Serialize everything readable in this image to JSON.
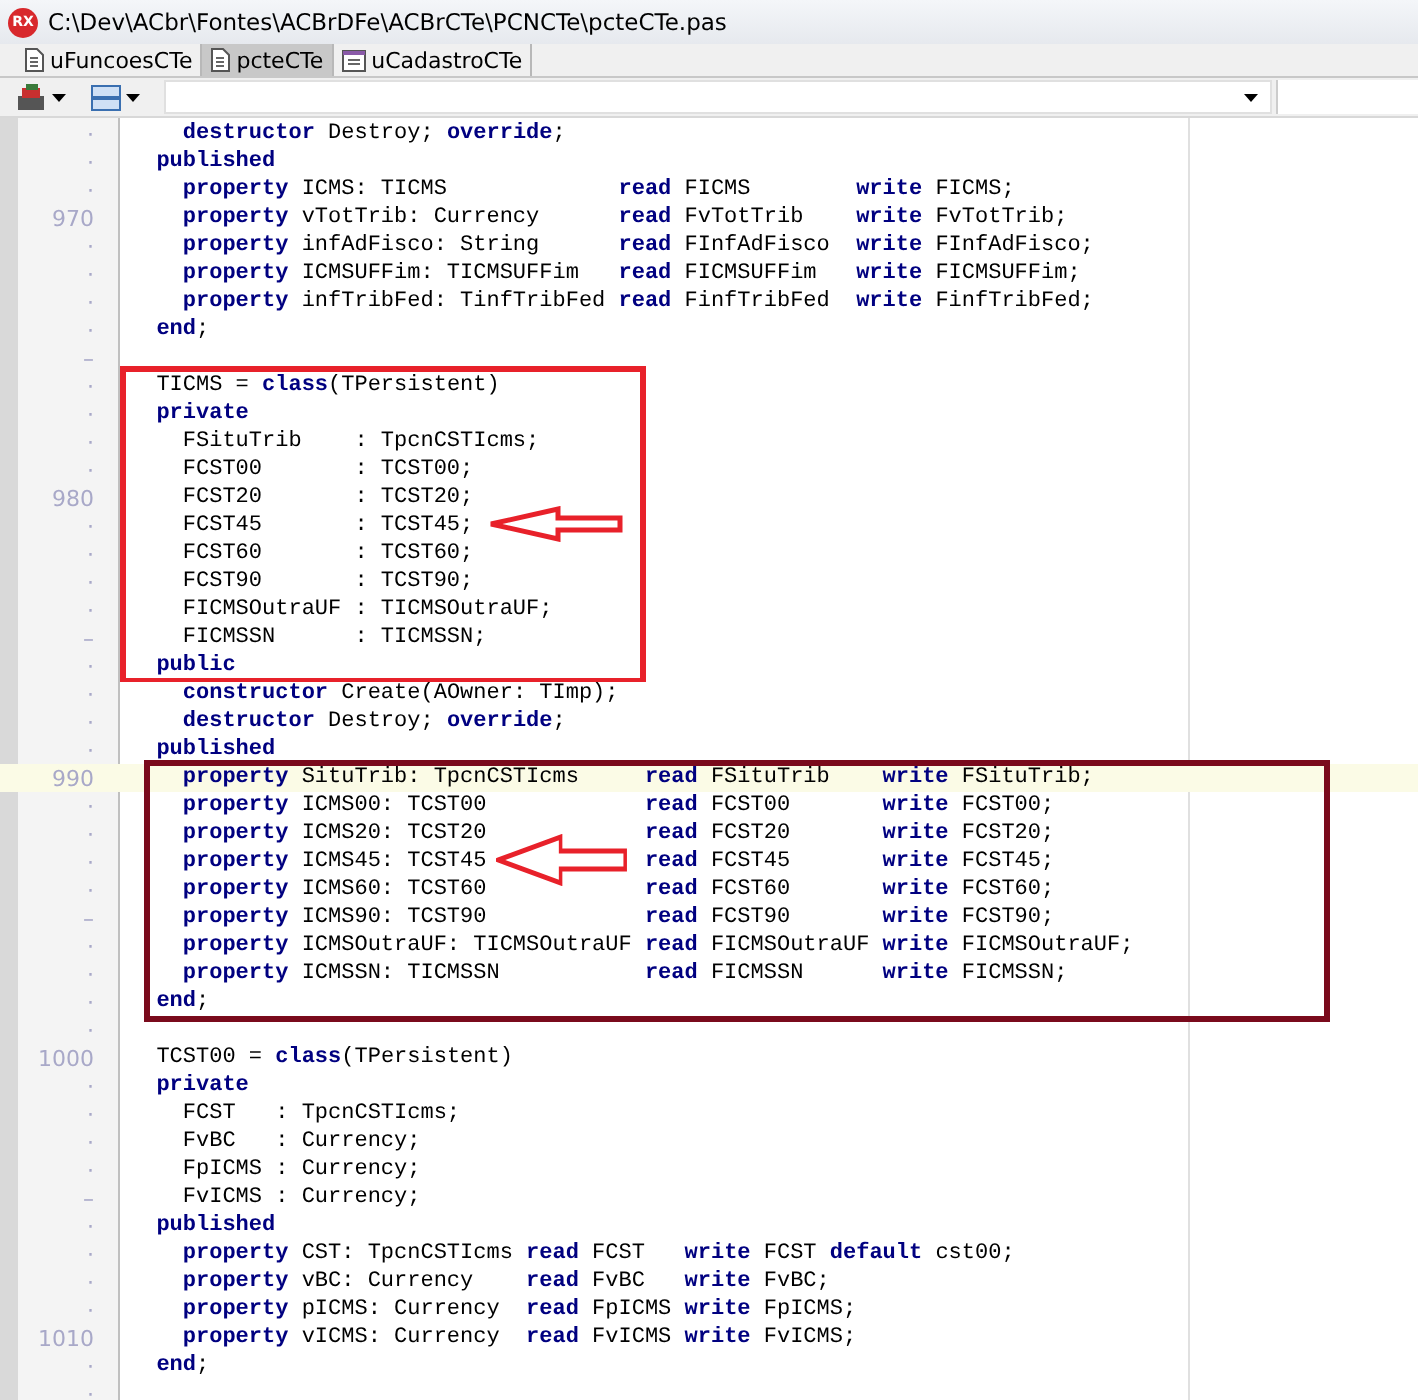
{
  "window": {
    "badge": "RX",
    "title": "C:\\Dev\\ACbr\\Fontes\\ACBrDFe\\ACBrCTe\\PCNCTe\\pcteCTe.pas"
  },
  "tabs": [
    {
      "label": "uFuncoesCTe",
      "selected": false,
      "kind": "unit"
    },
    {
      "label": "pcteCTe",
      "selected": true,
      "kind": "unit"
    },
    {
      "label": "uCadastroCTe",
      "selected": false,
      "kind": "form"
    }
  ],
  "editor": {
    "lines": [
      {
        "gutter": "·",
        "current": false,
        "code": "    **destructor** Destroy; **override**;"
      },
      {
        "gutter": "·",
        "current": false,
        "code": "  **published**"
      },
      {
        "gutter": "·",
        "current": false,
        "code": "    **property** ICMS: TICMS             **read** FICMS        **write** FICMS;"
      },
      {
        "gutter": "970",
        "current": false,
        "code": "    **property** vTotTrib: Currency      **read** FvTotTrib    **write** FvTotTrib;"
      },
      {
        "gutter": "·",
        "current": false,
        "code": "    **property** infAdFisco: String      **read** FInfAdFisco  **write** FInfAdFisco;"
      },
      {
        "gutter": "·",
        "current": false,
        "code": "    **property** ICMSUFFim: TICMSUFFim   **read** FICMSUFFim   **write** FICMSUFFim;"
      },
      {
        "gutter": "·",
        "current": false,
        "code": "    **property** infTribFed: TinfTribFed **read** FinfTribFed  **write** FinfTribFed;"
      },
      {
        "gutter": "·",
        "current": false,
        "code": "  **end**;"
      },
      {
        "gutter": "–",
        "current": false
      },
      {
        "gutter": "·",
        "current": false,
        "code": "  TICMS = **class**(TPersistent)"
      },
      {
        "gutter": "·",
        "current": false,
        "code": "  **private**"
      },
      {
        "gutter": "·",
        "current": false,
        "code": "    FSituTrib    : TpcnCSTIcms;"
      },
      {
        "gutter": "·",
        "current": false,
        "code": "    FCST00       : TCST00;"
      },
      {
        "gutter": "980",
        "current": false,
        "code": "    FCST20       : TCST20;"
      },
      {
        "gutter": "·",
        "current": false,
        "code": "    FCST45       : TCST45;"
      },
      {
        "gutter": "·",
        "current": false,
        "code": "    FCST60       : TCST60;"
      },
      {
        "gutter": "·",
        "current": false,
        "code": "    FCST90       : TCST90;"
      },
      {
        "gutter": "·",
        "current": false,
        "code": "    FICMSOutraUF : TICMSOutraUF;"
      },
      {
        "gutter": "–",
        "current": false,
        "code": "    FICMSSN      : TICMSSN;"
      },
      {
        "gutter": "·",
        "current": false,
        "code": "  **public**"
      },
      {
        "gutter": "·",
        "current": false,
        "code": "    **constructor** Create(AOwner: TImp);"
      },
      {
        "gutter": "·",
        "current": false,
        "code": "    **destructor** Destroy; **override**;"
      },
      {
        "gutter": "·",
        "current": false,
        "code": "  **published**"
      },
      {
        "gutter": "990",
        "current": true,
        "code": "    **property** SituTrib: TpcnCSTIcms     **read** FSituTrib    **write** FSituTrib;"
      },
      {
        "gutter": "·",
        "current": false,
        "code": "    **property** ICMS00: TCST00            **read** FCST00       **write** FCST00;"
      },
      {
        "gutter": "·",
        "current": false,
        "code": "    **property** ICMS20: TCST20            **read** FCST20       **write** FCST20;"
      },
      {
        "gutter": "·",
        "current": false,
        "code": "    **property** ICMS45: TCST45            **read** FCST45       **write** FCST45;"
      },
      {
        "gutter": "·",
        "current": false,
        "code": "    **property** ICMS60: TCST60            **read** FCST60       **write** FCST60;"
      },
      {
        "gutter": "–",
        "current": false,
        "code": "    **property** ICMS90: TCST90            **read** FCST90       **write** FCST90;"
      },
      {
        "gutter": "·",
        "current": false,
        "code": "    **property** ICMSOutraUF: TICMSOutraUF **read** FICMSOutraUF **write** FICMSOutraUF;"
      },
      {
        "gutter": "·",
        "current": false,
        "code": "    **property** ICMSSN: TICMSSN           **read** FICMSSN      **write** FICMSSN;"
      },
      {
        "gutter": "·",
        "current": false,
        "code": "  **end**;"
      },
      {
        "gutter": "·",
        "current": false
      },
      {
        "gutter": "1000",
        "current": false,
        "code": "  TCST00 = **class**(TPersistent)"
      },
      {
        "gutter": "·",
        "current": false,
        "code": "  **private**"
      },
      {
        "gutter": "·",
        "current": false,
        "code": "    FCST   : TpcnCSTIcms;"
      },
      {
        "gutter": "·",
        "current": false,
        "code": "    FvBC   : Currency;"
      },
      {
        "gutter": "·",
        "current": false,
        "code": "    FpICMS : Currency;"
      },
      {
        "gutter": "–",
        "current": false,
        "code": "    FvICMS : Currency;"
      },
      {
        "gutter": "·",
        "current": false,
        "code": "  **published**"
      },
      {
        "gutter": "·",
        "current": false,
        "code": "    **property** CST: TpcnCSTIcms **read** FCST   **write** FCST **default** cst00;"
      },
      {
        "gutter": "·",
        "current": false,
        "code": "    **property** vBC: Currency    **read** FvBC   **write** FvBC;"
      },
      {
        "gutter": "·",
        "current": false,
        "code": "    **property** pICMS: Currency  **read** FpICMS **write** FpICMS;"
      },
      {
        "gutter": "1010",
        "current": false,
        "code": "    **property** vICMS: Currency  **read** FvICMS **write** FvICMS;"
      },
      {
        "gutter": "·",
        "current": false,
        "code": "  **end**;"
      },
      {
        "gutter": "·",
        "current": false
      }
    ]
  }
}
